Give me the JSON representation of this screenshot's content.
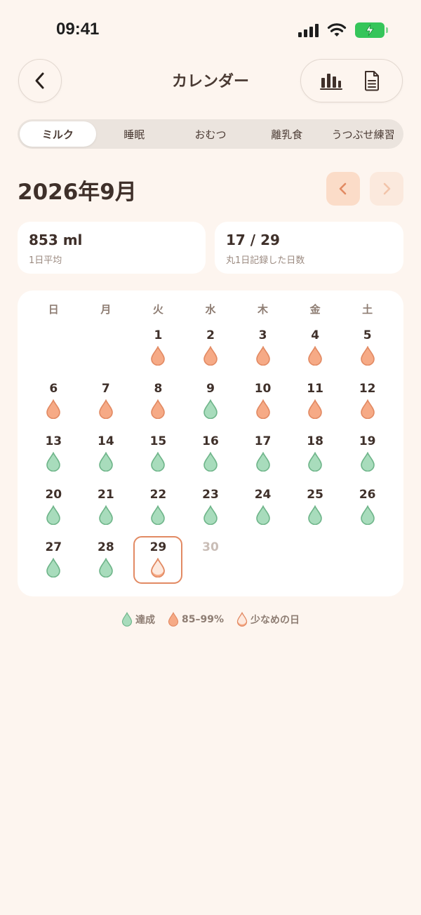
{
  "status_bar": {
    "time": "09:41"
  },
  "nav": {
    "title": "カレンダー"
  },
  "tabs": [
    {
      "label": "ミルク",
      "active": true
    },
    {
      "label": "睡眠",
      "active": false
    },
    {
      "label": "おむつ",
      "active": false
    },
    {
      "label": "離乳食",
      "active": false
    },
    {
      "label": "うつぶせ練習",
      "active": false
    }
  ],
  "month": {
    "title": "2026年9月"
  },
  "stats": {
    "average": {
      "value": "853 ml",
      "label": "1日平均"
    },
    "recorded": {
      "value": "17 / 29",
      "label": "丸1日記録した日数"
    }
  },
  "calendar": {
    "weekdays": [
      "日",
      "月",
      "火",
      "水",
      "木",
      "金",
      "土"
    ],
    "first_weekday_index": 2,
    "days": [
      {
        "day": "1",
        "status": "partial"
      },
      {
        "day": "2",
        "status": "partial"
      },
      {
        "day": "3",
        "status": "partial"
      },
      {
        "day": "4",
        "status": "partial"
      },
      {
        "day": "5",
        "status": "partial"
      },
      {
        "day": "6",
        "status": "partial"
      },
      {
        "day": "7",
        "status": "partial"
      },
      {
        "day": "8",
        "status": "partial"
      },
      {
        "day": "9",
        "status": "achieved"
      },
      {
        "day": "10",
        "status": "partial"
      },
      {
        "day": "11",
        "status": "partial"
      },
      {
        "day": "12",
        "status": "partial"
      },
      {
        "day": "13",
        "status": "achieved"
      },
      {
        "day": "14",
        "status": "achieved"
      },
      {
        "day": "15",
        "status": "achieved"
      },
      {
        "day": "16",
        "status": "achieved"
      },
      {
        "day": "17",
        "status": "achieved"
      },
      {
        "day": "18",
        "status": "achieved"
      },
      {
        "day": "19",
        "status": "achieved"
      },
      {
        "day": "20",
        "status": "achieved"
      },
      {
        "day": "21",
        "status": "achieved"
      },
      {
        "day": "22",
        "status": "achieved"
      },
      {
        "day": "23",
        "status": "achieved"
      },
      {
        "day": "24",
        "status": "achieved"
      },
      {
        "day": "25",
        "status": "achieved"
      },
      {
        "day": "26",
        "status": "achieved"
      },
      {
        "day": "27",
        "status": "achieved"
      },
      {
        "day": "28",
        "status": "achieved"
      },
      {
        "day": "29",
        "status": "low",
        "today": true
      },
      {
        "day": "30",
        "status": "future"
      }
    ]
  },
  "legend": [
    {
      "label": "達成",
      "status": "achieved"
    },
    {
      "label": "85–99%",
      "status": "partial"
    },
    {
      "label": "少なめの日",
      "status": "low"
    }
  ],
  "colors": {
    "background": "#fdf5ef",
    "achieved_fill": "#a8dcbc",
    "achieved_stroke": "#6fb58a",
    "partial_fill": "#f6aa86",
    "partial_stroke": "#e28a63",
    "accent": "#e28a63"
  }
}
